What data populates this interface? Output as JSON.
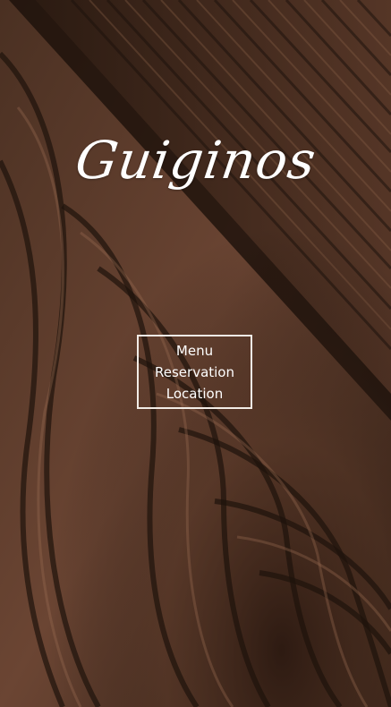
{
  "brand": {
    "name": "Guiginos"
  },
  "nav": {
    "items": [
      {
        "label": "Menu"
      },
      {
        "label": "Reservation"
      },
      {
        "label": "Location"
      }
    ]
  },
  "theme": {
    "background": "#3a2518",
    "wood_dark": "#1e130c",
    "wood_mid": "#5a3a28",
    "wood_light": "#8a6048",
    "text": "#ffffff",
    "border": "#f2ece6"
  }
}
